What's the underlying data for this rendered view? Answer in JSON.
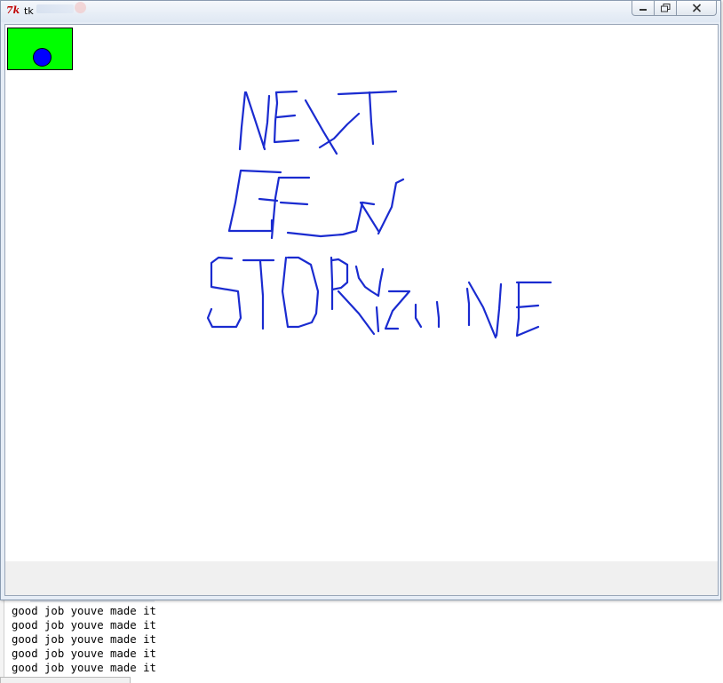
{
  "window": {
    "title": "tk",
    "icon": "tk-feather-icon",
    "controls": {
      "minimize": "minimize-icon",
      "maximize": "maximize-icon",
      "close": "close-icon"
    }
  },
  "canvas": {
    "button": {
      "fill": "#00ff00",
      "dot": "#0000ff"
    },
    "drawing": {
      "color": "#1a2bd0",
      "lines": [
        "NEXT",
        "GEN",
        "STORYLINE"
      ]
    }
  },
  "terminal": {
    "lines": [
      "good job youve made it",
      "good job youve made it",
      "good job youve made it",
      "good job youve made it",
      "good job youve made it"
    ]
  }
}
